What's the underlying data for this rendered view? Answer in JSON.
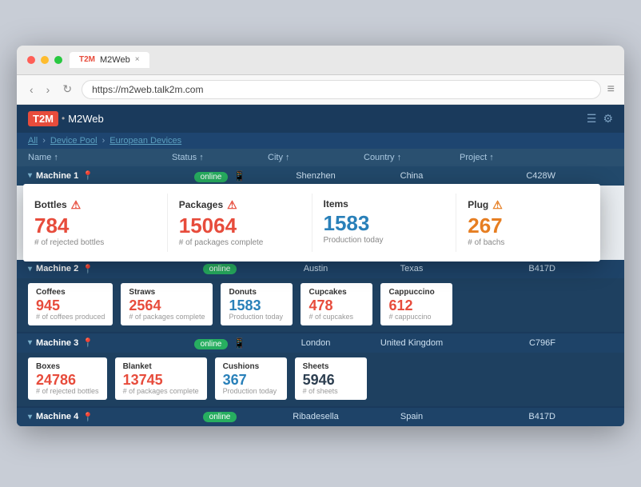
{
  "browser": {
    "tab_favicon": "T2M",
    "tab_title": "M2Web",
    "tab_close": "×",
    "nav_back": "‹",
    "nav_forward": "›",
    "nav_reload": "↻",
    "address": "https://m2web.talk2m.com",
    "menu_icon": "≡"
  },
  "app": {
    "logo_badge": "T2M",
    "logo_name": "M2Web",
    "header_icon1": "☰",
    "header_icon2": "⚙"
  },
  "breadcrumb": {
    "all": "All",
    "device_pool": "Device Pool",
    "european_devices": "European Devices"
  },
  "table_header": {
    "name": "Name ↑",
    "status": "Status ↑",
    "city": "City ↑",
    "country": "Country ↑",
    "project": "Project ↑"
  },
  "machines": [
    {
      "name": "Machine 1",
      "status": "online",
      "has_phone": true,
      "city": "Shenzhen",
      "country": "China",
      "project": "C428W",
      "metrics": [
        {
          "label": "Bottles",
          "value": "784",
          "color": "red",
          "sub": "# of rejected bottles",
          "warn": true,
          "warn_color": "red"
        },
        {
          "label": "Packages",
          "value": "15064",
          "color": "red",
          "sub": "# of packages complete",
          "warn": true,
          "warn_color": "red"
        },
        {
          "label": "Items",
          "value": "1583",
          "color": "blue",
          "sub": "Production today",
          "warn": false
        },
        {
          "label": "Plug",
          "value": "267",
          "color": "orange",
          "sub": "# of bachs",
          "warn": true,
          "warn_color": "orange"
        }
      ]
    },
    {
      "name": "Machine 2",
      "status": "online",
      "has_phone": false,
      "city": "Austin",
      "country": "Texas",
      "project": "B417D",
      "metrics": [
        {
          "label": "Coffees",
          "value": "945",
          "color": "red",
          "sub": "# of coffees produced",
          "warn": false
        },
        {
          "label": "Straws",
          "value": "2564",
          "color": "red",
          "sub": "# of packages complete",
          "warn": false
        },
        {
          "label": "Donuts",
          "value": "1583",
          "color": "blue",
          "sub": "Production today",
          "warn": false
        },
        {
          "label": "Cupcakes",
          "value": "478",
          "color": "red",
          "sub": "# of cupcakes",
          "warn": false
        },
        {
          "label": "Cappuccino",
          "value": "612",
          "color": "red",
          "sub": "# cappuccino",
          "warn": false
        }
      ]
    },
    {
      "name": "Machine 3",
      "status": "online",
      "has_phone": true,
      "city": "London",
      "country": "United Kingdom",
      "project": "C796F",
      "metrics": [
        {
          "label": "Boxes",
          "value": "24786",
          "color": "red",
          "sub": "# of rejected bottles",
          "warn": false
        },
        {
          "label": "Blanket",
          "value": "13745",
          "color": "red",
          "sub": "# of packages complete",
          "warn": false
        },
        {
          "label": "Cushions",
          "value": "367",
          "color": "blue",
          "sub": "Production today",
          "warn": false
        },
        {
          "label": "Sheets",
          "value": "5946",
          "color": "dark",
          "sub": "# of sheets",
          "warn": false
        }
      ]
    },
    {
      "name": "Machine 4",
      "status": "online",
      "has_phone": false,
      "city": "Ribadesella",
      "country": "Spain",
      "project": "B417D",
      "metrics": []
    }
  ]
}
